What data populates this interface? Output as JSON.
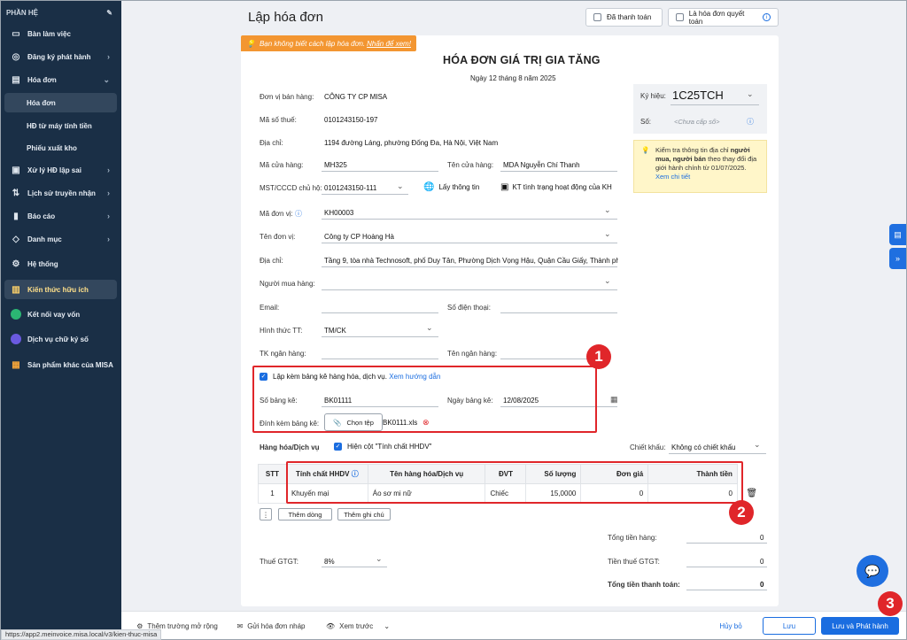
{
  "sidebar": {
    "header": "PHẦN HỆ",
    "items": [
      {
        "label": "Bàn làm việc",
        "icon": "monitor-icon"
      },
      {
        "label": "Đăng ký phát hành",
        "icon": "stamp-icon"
      },
      {
        "label": "Hóa đơn",
        "icon": "document-icon"
      },
      {
        "label": "Hóa đơn",
        "icon": ""
      },
      {
        "label": "HĐ từ máy tính tiền",
        "icon": ""
      },
      {
        "label": "Phiếu xuất kho",
        "icon": ""
      },
      {
        "label": "Xử lý HĐ lập sai",
        "icon": "edit-doc-icon"
      },
      {
        "label": "Lịch sử truyền nhận",
        "icon": "transfer-icon"
      },
      {
        "label": "Báo cáo",
        "icon": "bar-chart-icon"
      },
      {
        "label": "Danh mục",
        "icon": "cube-icon"
      },
      {
        "label": "Hệ thống",
        "icon": "gear-icon"
      },
      {
        "label": "Kiến thức hữu ích",
        "icon": "book-icon"
      },
      {
        "label": "Kết nối vay vốn",
        "icon": "loan-icon"
      },
      {
        "label": "Dịch vụ chữ ký số",
        "icon": "signature-icon"
      },
      {
        "label": "Sản phẩm khác của MISA",
        "icon": "apps-icon"
      }
    ]
  },
  "header": {
    "title": "Lập hóa đơn",
    "paid_label": "Đã thanh toán",
    "final_label": "Là hóa đơn quyết toán"
  },
  "hint": {
    "text": "Bạn không biết cách lập hóa đơn.",
    "link": "Nhấn để xem!"
  },
  "invoice": {
    "title": "HÓA ĐƠN GIÁ TRỊ GIA TĂNG",
    "date": "Ngày 12 tháng 8 năm 2025",
    "seller_label": "Đơn vị bán hàng:",
    "seller": "CÔNG TY CP MISA",
    "taxcode_label": "Mã số thuế:",
    "taxcode": "0101243150-197",
    "address_label": "Địa chỉ:",
    "address": "1194 đường Láng, phường Đống Đa, Hà Nội, Việt Nam",
    "store_code_label": "Mã cửa hàng:",
    "store_code": "MH325",
    "store_name_label": "Tên cửa hàng:",
    "store_name": "MDA Nguyễn Chí Thanh",
    "mst_label": "MST/CCCD chủ hộ:",
    "mst": "0101243150-111",
    "lookup_label": "Lấy thông tin",
    "check_label": "KT tình trạng hoạt động của KH",
    "unit_code_label": "Mã đơn vị:",
    "unit_code": "KH00003",
    "unit_name_label": "Tên đơn vị:",
    "unit_name": "Công ty CP Hoàng Hà",
    "buyer_addr_label": "Địa chỉ:",
    "buyer_addr": "Tầng 9, tòa nhà Technosoft, phố Duy Tân, Phường Dịch Vọng Hậu, Quận Cầu Giấy, Thành phố H",
    "buyer_label": "Người mua hàng:",
    "email_label": "Email:",
    "phone_label": "Số điện thoại:",
    "payment_label": "Hình thức TT:",
    "payment": "TM/CK",
    "bank_acc_label": "TK ngân hàng:",
    "bank_name_label": "Tên ngân hàng:",
    "attach_check": "Lập kèm bảng kê hàng hóa, dịch vụ.",
    "attach_link": "Xem hướng dẫn",
    "list_no_label": "Số bảng kê:",
    "list_no": "BK01111",
    "list_date_label": "Ngày bảng kê:",
    "list_date": "12/08/2025",
    "list_file_label": "Đính kèm bảng kê:",
    "choose_file": "Chọn tệp",
    "file_name": "BK0111.xls"
  },
  "serial": {
    "symbol_label": "Ký hiệu:",
    "symbol": "1C25TCH",
    "number_label": "Số:",
    "number_placeholder": "<Chưa cấp số>"
  },
  "note": {
    "pre": "Kiểm tra thông tin địa chỉ",
    "bold": "người mua, người bán",
    "post": "theo thay đổi địa giới hành chính từ 01/07/2025.",
    "link": "Xem chi tiết"
  },
  "goods": {
    "label": "Hàng hóa/Dịch vụ",
    "show_col": "Hiện cột \"Tính chất HHDV\"",
    "discount_label": "Chiết khấu:",
    "discount": "Không có chiết khấu",
    "headers": [
      "STT",
      "Tính chất HHDV",
      "Tên hàng hóa/Dịch vụ",
      "ĐVT",
      "Số lượng",
      "Đơn giá",
      "Thành tiền"
    ],
    "rows": [
      [
        "1",
        "Khuyến mại",
        "Áo sơ mi nữ",
        "Chiếc",
        "15,0000",
        "0",
        "0"
      ]
    ],
    "add_row": "Thêm dòng",
    "add_note": "Thêm ghi chú"
  },
  "totals": {
    "goods_label": "Tổng tiền hàng:",
    "goods": "0",
    "vat_rate_label": "Thuế GTGT:",
    "vat_rate": "8%",
    "vat_label": "Tiền thuế GTGT:",
    "vat": "0",
    "total_label": "Tổng tiền thanh toán:",
    "total": "0"
  },
  "footer": {
    "extra": "Thêm trường mở rộng",
    "draft": "Gửi hóa đơn nháp",
    "preview": "Xem trước",
    "cancel": "Hủy bỏ",
    "save": "Lưu",
    "save_issue": "Lưu và Phát hành"
  },
  "badges": [
    "1",
    "2",
    "3"
  ],
  "status_url": "https://app2.meinvoice.misa.local/v3/kien-thuc-misa",
  "colors": {
    "sidebar": "#1a2f46",
    "accent": "#1a6de0",
    "annotation": "#e0262a",
    "hint": "#f39631"
  }
}
